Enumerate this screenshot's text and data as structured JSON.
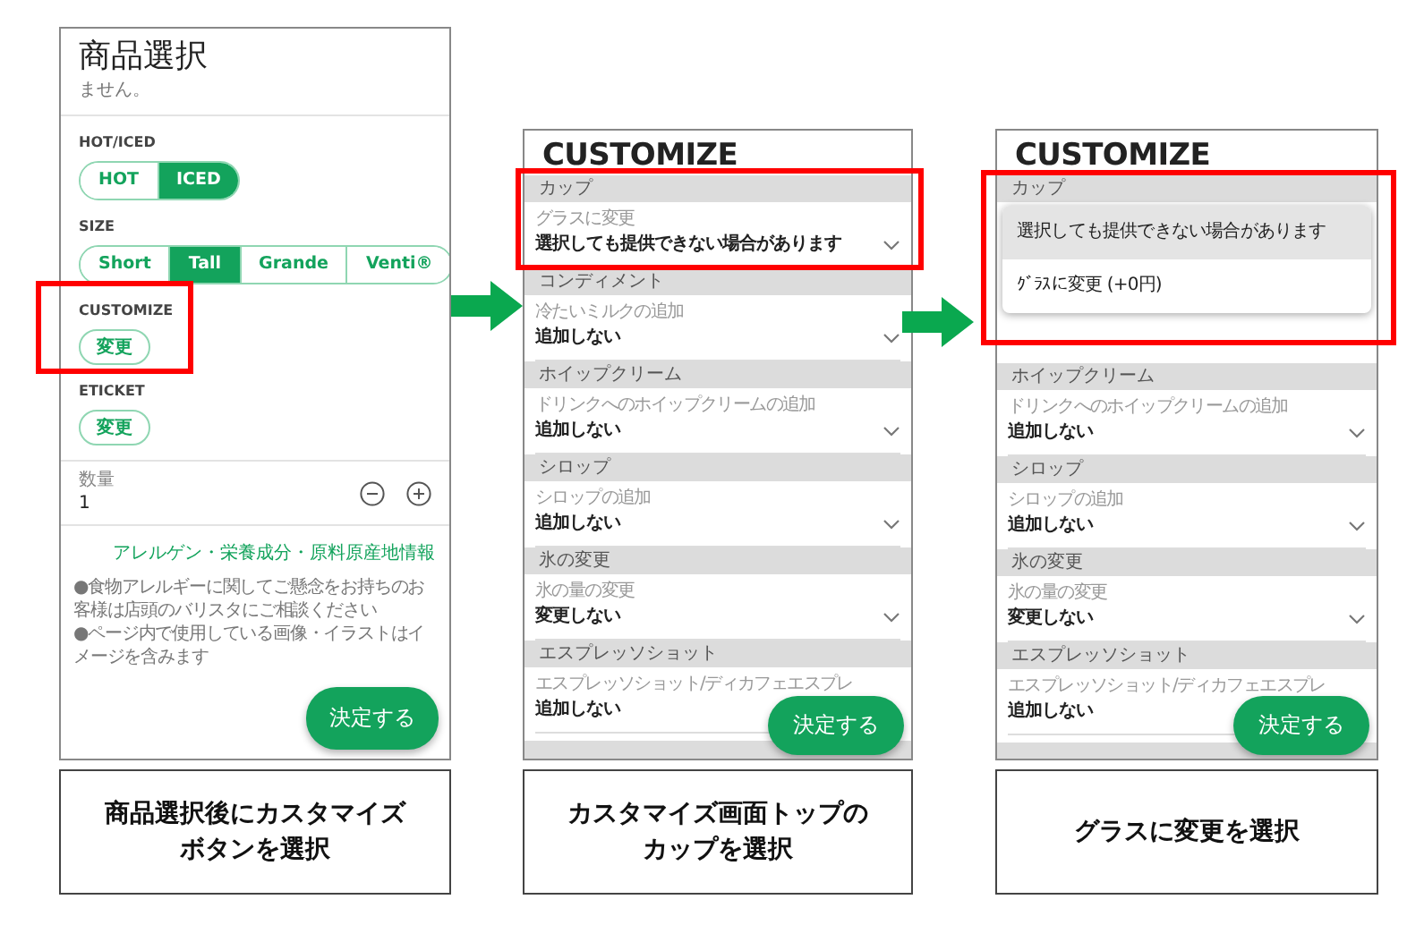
{
  "screens": [
    {
      "kind": "product",
      "title": "商品選択",
      "intro_tail": "ません。",
      "groups": [
        {
          "kind": "segmented",
          "label": "HOT/ICED",
          "options": [
            {
              "label": "HOT",
              "selected": false
            },
            {
              "label": "ICED",
              "selected": true
            }
          ]
        },
        {
          "kind": "segmented",
          "label": "SIZE",
          "options": [
            {
              "label": "Short",
              "selected": false
            },
            {
              "label": "Tall",
              "selected": true
            },
            {
              "label": "Grande",
              "selected": false
            },
            {
              "label": "Venti®",
              "selected": false
            }
          ]
        },
        {
          "kind": "button",
          "label": "CUSTOMIZE",
          "button": "変更"
        },
        {
          "kind": "button",
          "label": "ETICKET",
          "button": "変更"
        }
      ],
      "quantity": {
        "label": "数量",
        "value": "1"
      },
      "link": "アレルゲン・栄養成分・原料原産地情報",
      "notes": [
        "●食物アレルギーに関してご懸念をお持ちのお客様は店頭のバリスタにご相談ください",
        "●ページ内で使用している画像・イラストはイメージを含みます"
      ],
      "submit": "決定する",
      "caption": [
        "商品選択後にカスタマイズ",
        "ボタンを選択"
      ]
    },
    {
      "kind": "customize",
      "title": "CUSTOMIZE",
      "items": [
        {
          "kind": "header",
          "text": "カップ"
        },
        {
          "kind": "field",
          "label": "グラスに変更",
          "value": "選択しても提供できない場合があります",
          "chevron": true
        },
        {
          "kind": "header",
          "text": "コンディメント"
        },
        {
          "kind": "field",
          "label": "冷たいミルクの追加",
          "value": "追加しない",
          "chevron": true
        },
        {
          "kind": "header",
          "text": "ホイップクリーム"
        },
        {
          "kind": "field",
          "label": "ドリンクへのホイップクリームの追加",
          "value": "追加しない",
          "chevron": true
        },
        {
          "kind": "header",
          "text": "シロップ"
        },
        {
          "kind": "field",
          "label": "シロップの追加",
          "value": "追加しない",
          "chevron": true
        },
        {
          "kind": "header",
          "text": "氷の変更"
        },
        {
          "kind": "field",
          "label": "氷の量の変更",
          "value": "変更しない",
          "chevron": true
        },
        {
          "kind": "header",
          "text": "エスプレッソショット"
        },
        {
          "kind": "field",
          "label": "エスプレッソショット/ディカフェエスプレ",
          "value": "追加しない",
          "chevron": false
        }
      ],
      "submit": "決定する",
      "caption": [
        "カスタマイズ画面トップの",
        "カップを選択"
      ]
    },
    {
      "kind": "customize",
      "title": "CUSTOMIZE",
      "items": [
        {
          "kind": "header",
          "text": "カップ"
        },
        {
          "kind": "menu",
          "options": [
            {
              "label": "選択しても提供できない場合があります",
              "selected": true
            },
            {
              "label": "ｸﾞﾗｽに変更 (+0円)",
              "selected": false
            }
          ]
        },
        {
          "kind": "header",
          "text": "ホイップクリーム"
        },
        {
          "kind": "field",
          "label": "ドリンクへのホイップクリームの追加",
          "value": "追加しない",
          "chevron": true
        },
        {
          "kind": "header",
          "text": "シロップ"
        },
        {
          "kind": "field",
          "label": "シロップの追加",
          "value": "追加しない",
          "chevron": true
        },
        {
          "kind": "header",
          "text": "氷の変更"
        },
        {
          "kind": "field",
          "label": "氷の量の変更",
          "value": "変更しない",
          "chevron": true
        },
        {
          "kind": "header",
          "text": "エスプレッソショット"
        },
        {
          "kind": "field",
          "label": "エスプレッソショット/ディカフェエスプレ",
          "value": "追加しない",
          "chevron": false
        }
      ],
      "submit": "決定する",
      "caption": [
        "グラスに変更を選択"
      ]
    }
  ]
}
